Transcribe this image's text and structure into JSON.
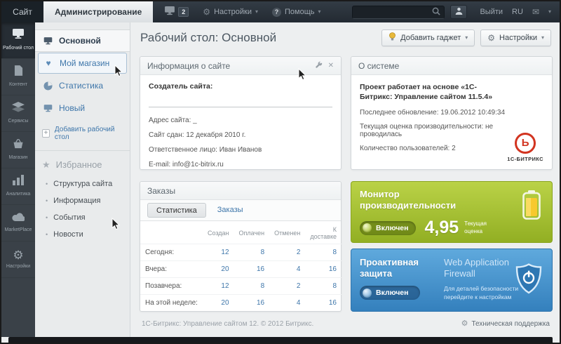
{
  "topbar": {
    "site_tab": "Сайт",
    "admin_tab": "Администрирование",
    "badge_count": "2",
    "settings_menu": "Настройки",
    "help_menu": "Помощь",
    "logout": "Выйти",
    "lang": "RU"
  },
  "iconbar": {
    "items": [
      {
        "label": "Рабочий стол"
      },
      {
        "label": "Контент"
      },
      {
        "label": "Сервисы"
      },
      {
        "label": "Магазин"
      },
      {
        "label": "Аналитика"
      },
      {
        "label": "MarketPlace"
      },
      {
        "label": "Настройки"
      }
    ]
  },
  "sidebar": {
    "items": [
      {
        "label": "Основной"
      },
      {
        "label": "Мой магазин"
      },
      {
        "label": "Статистика"
      },
      {
        "label": "Новый"
      }
    ],
    "add_desktop": "Добавить рабочий стол",
    "favorites_title": "Избранное",
    "favorites": [
      {
        "label": "Структура сайта"
      },
      {
        "label": "Информация"
      },
      {
        "label": "События"
      },
      {
        "label": "Новости"
      }
    ]
  },
  "header": {
    "title": "Рабочий стол: Основной",
    "add_gadget_button": "Добавить гаджет",
    "settings_button": "Настройки"
  },
  "widgets": {
    "site_info": {
      "title": "Информация о сайте",
      "creator_label": "Создатель сайта:",
      "rows": [
        {
          "label": "Адрес сайта:",
          "value": "_"
        },
        {
          "label": "Сайт сдан:",
          "value": "12 декабря 2010 г."
        },
        {
          "label": "Ответственное лицо:",
          "value": "Иван Иванов"
        },
        {
          "label": "E-mail:",
          "value": "info@1c-bitrix.ru"
        }
      ]
    },
    "about": {
      "title": "О системе",
      "headline": "Проект работает на основе «1С-Битрикс: Управление сайтом 11.5.4»",
      "lines": [
        "Последнее обновление: 19.06.2012 10:49:34",
        "Текущая оценка производительности: не проводилась",
        "Количество пользователей: 2"
      ],
      "logo_letter": "Ь",
      "logo_text": "1С-БИТРИКС"
    },
    "orders": {
      "title": "Заказы",
      "tabs": [
        {
          "label": "Статистика"
        },
        {
          "label": "Заказы"
        }
      ],
      "columns": [
        "Создан",
        "Оплачен",
        "Отменен",
        "К доставке"
      ],
      "rows": [
        {
          "label": "Сегодня:",
          "values": [
            "12",
            "8",
            "2",
            "8"
          ]
        },
        {
          "label": "Вчера:",
          "values": [
            "20",
            "16",
            "4",
            "16"
          ]
        },
        {
          "label": "Позавчера:",
          "values": [
            "12",
            "8",
            "2",
            "8"
          ]
        },
        {
          "label": "На этой неделе:",
          "values": [
            "20",
            "16",
            "4",
            "16"
          ]
        }
      ]
    },
    "performance": {
      "title": "Монитор производительности",
      "status_label": "Включен",
      "score": "4,95",
      "score_caption": "Текущая оценка"
    },
    "security": {
      "title": "Проактивная защита",
      "subtitle": "Web Application Firewall",
      "status_label": "Включен",
      "note": "Для деталей безопасности перейдите к настройкам"
    }
  },
  "footer": {
    "copyright": "1С-Битрикс: Управление сайтом 12. © 2012 Битрикс.",
    "support": "Техническая поддержка"
  },
  "colors": {
    "accent_blue": "#3e76aa",
    "green_widget": "#a3bf2e",
    "blue_widget": "#4694cf",
    "logo_red": "#d23420"
  }
}
